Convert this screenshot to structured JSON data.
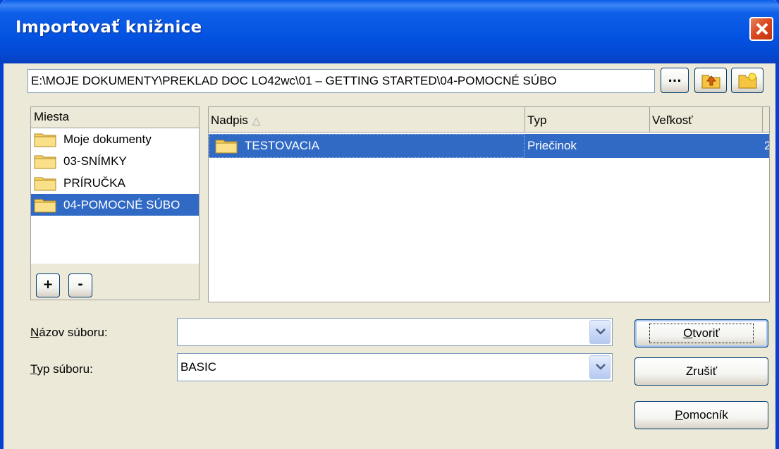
{
  "window": {
    "title": "Importovať knižnice"
  },
  "toolbar": {
    "path": "E:\\MOJE DOKUMENTY\\PREKLAD DOC LO42wc\\01 – GETTING STARTED\\04-POMOCNÉ SÚBO",
    "browse_label": "...",
    "icons": [
      "folder-up-icon",
      "new-folder-icon"
    ]
  },
  "places": {
    "header": "Miesta",
    "items": [
      {
        "label": "Moje dokumenty",
        "selected": false
      },
      {
        "label": "03-SNÍMKY",
        "selected": false
      },
      {
        "label": "PRÍRUČKA",
        "selected": false
      },
      {
        "label": "04-POMOCNÉ SÚBO",
        "selected": true
      }
    ],
    "add_label": "+",
    "remove_label": "-"
  },
  "files": {
    "columns": [
      "Nadpis",
      "Typ",
      "Veľkosť",
      ""
    ],
    "sort_indicator": "△",
    "rows": [
      {
        "name": "TESTOVACIA",
        "type": "Priečinok",
        "size": "",
        "extra": "2"
      }
    ]
  },
  "form": {
    "filename_label_u": "N",
    "filename_label_rest": "ázov súboru:",
    "filename_value": "",
    "filetype_label_u": "T",
    "filetype_label_rest": "yp súboru:",
    "filetype_value": "BASIC"
  },
  "buttons": {
    "open_u": "O",
    "open_rest": "tvoriť",
    "cancel": "Zrušiť",
    "help_u": "P",
    "help_rest": "omocník"
  },
  "colors": {
    "selection": "#316ac5",
    "titlebar": "#0453e2",
    "dialog_bg": "#ece9d8"
  }
}
